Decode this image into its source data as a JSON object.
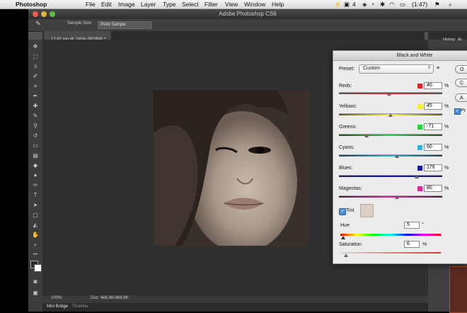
{
  "menubar": {
    "apple_icon": "apple-icon",
    "app_name": "Photoshop",
    "items": [
      "File",
      "Edit",
      "Image",
      "Layer",
      "Type",
      "Select",
      "Filter",
      "View",
      "Window",
      "Help"
    ],
    "status_items": [
      "4",
      "(1:47)"
    ]
  },
  "window": {
    "title": "Adobe Photoshop CS6"
  },
  "options_bar": {
    "sample_size_label": "Sample Size:",
    "sample_size_value": "Point Sample"
  },
  "document": {
    "tab_title": "17-51.jpg @ 100% (RGB/8) *"
  },
  "status_bar": {
    "zoom": "100%",
    "doc_info": "Doc: 468.8K/468.8K"
  },
  "bottom_tabs": {
    "mini_bridge": "Mini Bridge",
    "timeline": "Timeline"
  },
  "right_panel": {
    "tab1": "History",
    "tab2": "Ac"
  },
  "bw": {
    "title": "Black and White",
    "preset_label": "Preset:",
    "preset_value": "Custom",
    "channels": [
      {
        "label": "Reds:",
        "value": "40",
        "unit": "%",
        "color": "#e0202a",
        "slider": 0.4
      },
      {
        "label": "Yellows:",
        "value": "45",
        "unit": "%",
        "color": "#f4f22a",
        "slider": 0.42
      },
      {
        "label": "Greens:",
        "value": "-71",
        "unit": "%",
        "color": "#27d43a",
        "slider": 0.18
      },
      {
        "label": "Cyans:",
        "value": "60",
        "unit": "%",
        "color": "#2ab1e8",
        "slider": 0.55
      },
      {
        "label": "Blues:",
        "value": "176",
        "unit": "%",
        "color": "#1a1aa8",
        "slider": 0.8
      },
      {
        "label": "Magentas:",
        "value": "80",
        "unit": "%",
        "color": "#e02596",
        "slider": 0.6
      }
    ],
    "tint_label": "Tint",
    "tint_checked": true,
    "tint_color": "#dccfc5",
    "hue_label": "Hue",
    "hue_value": "5",
    "hue_unit": "°",
    "saturation_label": "Saturation",
    "saturation_value": "6",
    "saturation_unit": "%",
    "buttons": [
      "O",
      "C",
      "A"
    ],
    "preview_label": "Pr"
  }
}
